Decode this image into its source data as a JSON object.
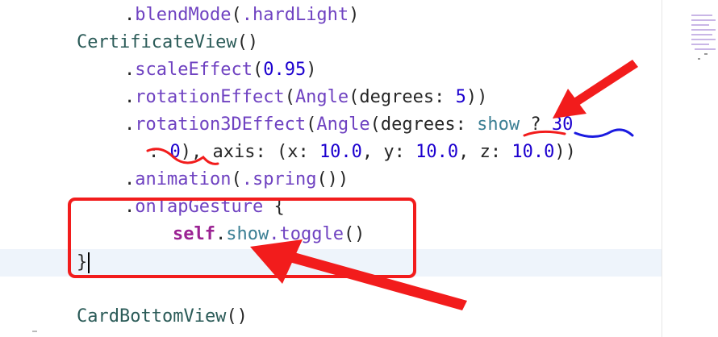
{
  "code": {
    "line0": {
      "dot": ".",
      "method": "blendMode",
      "open": "(",
      "arg": ".hardLight",
      "close": ")"
    },
    "line1": {
      "type": "CertificateView",
      "parens": "()"
    },
    "line2": {
      "dot": ".",
      "method": "scaleEffect",
      "open": "(",
      "num": "0.95",
      "close": ")"
    },
    "line3": {
      "dot": ".",
      "method": "rotationEffect",
      "open": "(",
      "type": "Angle",
      "args": "(degrees: ",
      "num": "5",
      "close": "))"
    },
    "line4": {
      "dot": ".",
      "method": "rotation3DEffect",
      "open": "(",
      "type": "Angle",
      "args": "(degrees: ",
      "var": "show",
      "ternary": " ? ",
      "num": "30"
    },
    "line5": {
      "colon": ": ",
      "num0": "0",
      "axis": "), axis: (x: ",
      "x": "10.0",
      "ysep": ", y: ",
      "y": "10.0",
      "zsep": ", z: ",
      "z": "10.0",
      "close": "))"
    },
    "line6": {
      "dot": ".",
      "method": "animation",
      "open": "(",
      "arg": ".spring",
      "close": "())"
    },
    "line7": {
      "dot": ".",
      "method": "onTapGesture",
      "brace": " {"
    },
    "line8": {
      "kw": "self",
      "dot": ".",
      "var": "show",
      "call": ".toggle",
      "parens": "()"
    },
    "line9": {
      "brace": "}"
    },
    "line11": {
      "type": "CardBottomView",
      "parens": "()"
    }
  },
  "colors": {
    "annotation_red": "#f21c1c",
    "annotation_blue": "#1a1ae0",
    "current_line": "#eef4fb"
  }
}
